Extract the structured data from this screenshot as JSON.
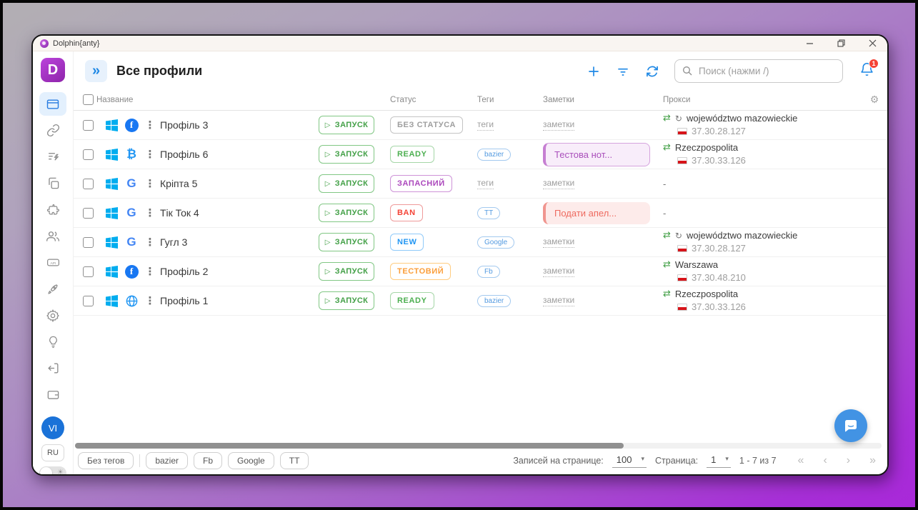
{
  "window": {
    "title": "Dolphin{anty}"
  },
  "sidebar": {
    "logo_letter": "D",
    "icons": [
      "browser-profiles-icon",
      "link-icon",
      "automation-icon",
      "pages-icon",
      "extensions-icon",
      "team-icon",
      "api-icon",
      "rocket-icon",
      "settings-icon",
      "lightbulb-icon",
      "logout-icon",
      "wallet-icon"
    ],
    "active_item": "browser-profiles-icon",
    "avatar": "VI",
    "language": "RU"
  },
  "header": {
    "title": "Все профили",
    "search_placeholder": "Поиск (нажми /)",
    "notification_count": "1"
  },
  "table": {
    "columns": {
      "name": "Название",
      "status": "Статус",
      "tags": "Теги",
      "notes": "Заметки",
      "proxy": "Прокси"
    },
    "launch_label": "ЗАПУСК",
    "rows": [
      {
        "name": "Профіль 3",
        "os_icon": "windows-icon",
        "browser_icon": "facebook-icon",
        "status": "БЕЗ СТАТУСА",
        "status_color": "gray",
        "tag": "теги",
        "note": "заметки",
        "proxy_name": "województwo mazowieckie",
        "proxy_ip": "37.30.28.127",
        "proxy_rotating": true
      },
      {
        "name": "Профіль 6",
        "os_icon": "windows-icon",
        "browser_icon": "bitcoin-icon",
        "status": "READY",
        "status_color": "green",
        "tag": "bazier",
        "note": "Тестова нот...",
        "proxy_name": "Rzeczpospolita",
        "proxy_ip": "37.30.33.126",
        "proxy_rotating": false
      },
      {
        "name": "Кріпта 5",
        "os_icon": "windows-icon",
        "browser_icon": "google-icon",
        "status": "ЗАПАСНИЙ",
        "status_color": "purple",
        "tag": "теги",
        "note": "заметки",
        "proxy_name": "-",
        "proxy_ip": "",
        "proxy_rotating": false
      },
      {
        "name": "Тік Ток 4",
        "os_icon": "windows-icon",
        "browser_icon": "google-icon",
        "status": "BAN",
        "status_color": "red",
        "tag": "TT",
        "note": "Подати апел...",
        "proxy_name": "-",
        "proxy_ip": "",
        "proxy_rotating": false
      },
      {
        "name": "Гугл 3",
        "os_icon": "windows-icon",
        "browser_icon": "google-icon",
        "status": "NEW",
        "status_color": "blue",
        "tag": "Google",
        "note": "заметки",
        "proxy_name": "województwo mazowieckie",
        "proxy_ip": "37.30.28.127",
        "proxy_rotating": true
      },
      {
        "name": "Профіль 2",
        "os_icon": "windows-icon",
        "browser_icon": "facebook-icon",
        "status": "ТЕСТОВИЙ",
        "status_color": "orange",
        "tag": "Fb",
        "note": "заметки",
        "proxy_name": "Warszawa",
        "proxy_ip": "37.30.48.210",
        "proxy_rotating": false
      },
      {
        "name": "Профіль 1",
        "os_icon": "windows-icon",
        "browser_icon": "globe-icon",
        "status": "READY",
        "status_color": "green",
        "tag": "bazier",
        "note": "заметки",
        "proxy_name": "Rzeczpospolita",
        "proxy_ip": "37.30.33.126",
        "proxy_rotating": false
      }
    ]
  },
  "footer": {
    "tag_filters": [
      "Без тегов",
      "bazier",
      "Fb",
      "Google",
      "TT"
    ],
    "rows_per_page_label": "Записей на странице:",
    "rows_per_page": "100",
    "page_label": "Страница:",
    "page": "1",
    "range_text": "1 - 7 из 7"
  },
  "colors": {
    "accent_blue": "#1e88e5",
    "launch_green": "#43a047",
    "status_gray": "#9e9e9e",
    "status_green": "#4caf50",
    "status_purple": "#ab47bc",
    "status_red": "#f44336",
    "status_blue": "#2196f3",
    "status_orange": "#fb9e3a",
    "note_purple_bg": "#f8edfa",
    "note_red_bg": "#fdebea",
    "badge_red": "#f44336",
    "background_purple": "#a928d9"
  }
}
